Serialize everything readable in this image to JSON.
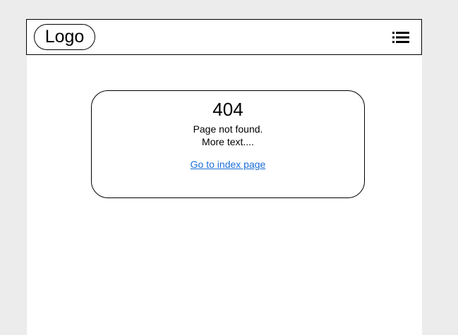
{
  "header": {
    "logo_label": "Logo",
    "menu_icon": "hamburger-list-icon"
  },
  "error": {
    "code": "404",
    "message": "Page not found.",
    "detail": "More text....",
    "link_label": "Go to index page"
  },
  "colors": {
    "background": "#ececec",
    "page": "#ffffff",
    "border": "#000000",
    "link": "#1a6ed8"
  }
}
